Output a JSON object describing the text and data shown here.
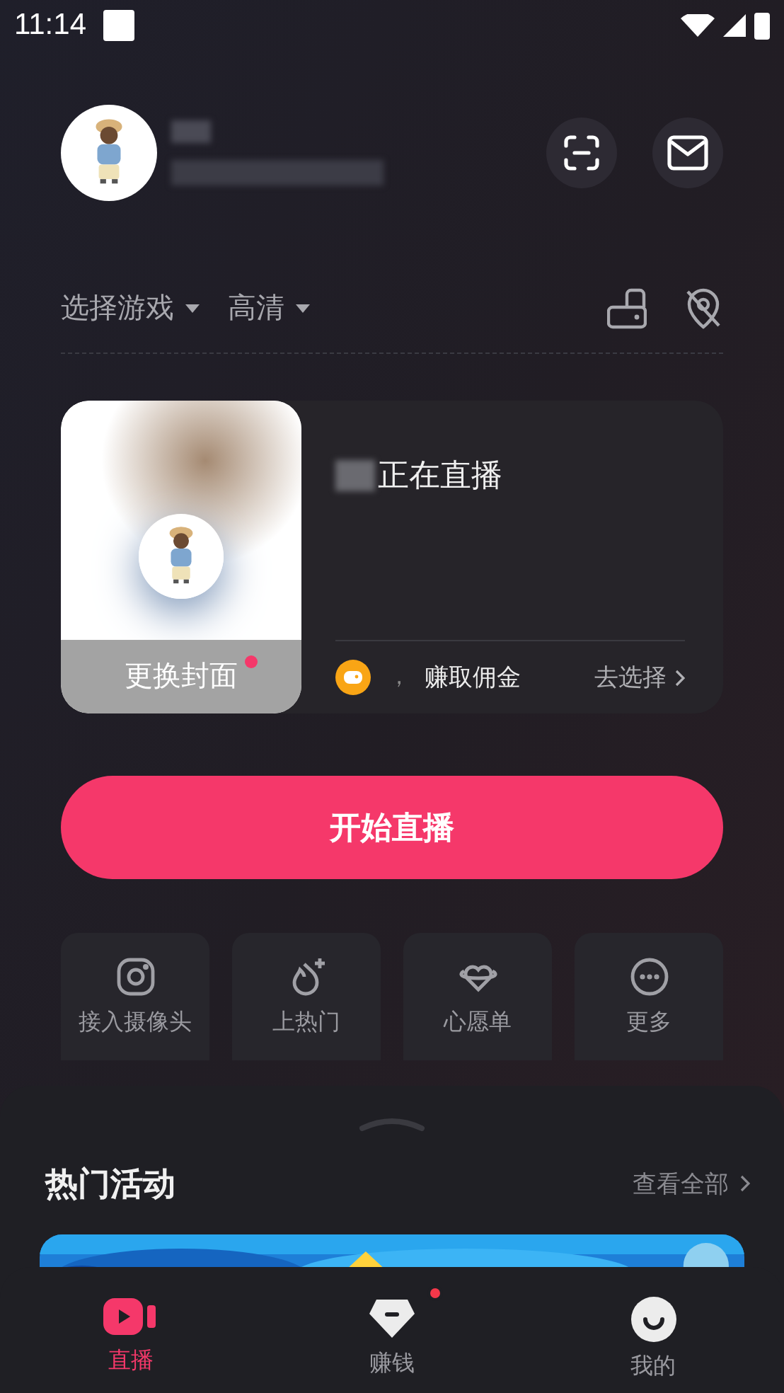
{
  "status_bar": {
    "time": "11:14"
  },
  "quality_bar": {
    "game_selector": "选择游戏",
    "quality_selector": "高清"
  },
  "live_card": {
    "title": "正在直播",
    "cover_button": "更换封面",
    "cover_badge": true,
    "commission_separator": "，",
    "commission_text": "赚取佣金",
    "select_link": "去选择"
  },
  "start_button": "开始直播",
  "tools": [
    {
      "label": "接入摄像头",
      "kind": "camera"
    },
    {
      "label": "上热门",
      "kind": "fire"
    },
    {
      "label": "心愿单",
      "kind": "wish"
    },
    {
      "label": "更多",
      "kind": "more"
    }
  ],
  "hot_activities": {
    "title": "热门活动",
    "view_all": "查看全部"
  },
  "bottom_nav": [
    {
      "label": "直播",
      "kind": "live",
      "selected": true,
      "badge": false
    },
    {
      "label": "赚钱",
      "kind": "earn",
      "selected": false,
      "badge": true
    },
    {
      "label": "我的",
      "kind": "me",
      "selected": false,
      "badge": false
    }
  ]
}
